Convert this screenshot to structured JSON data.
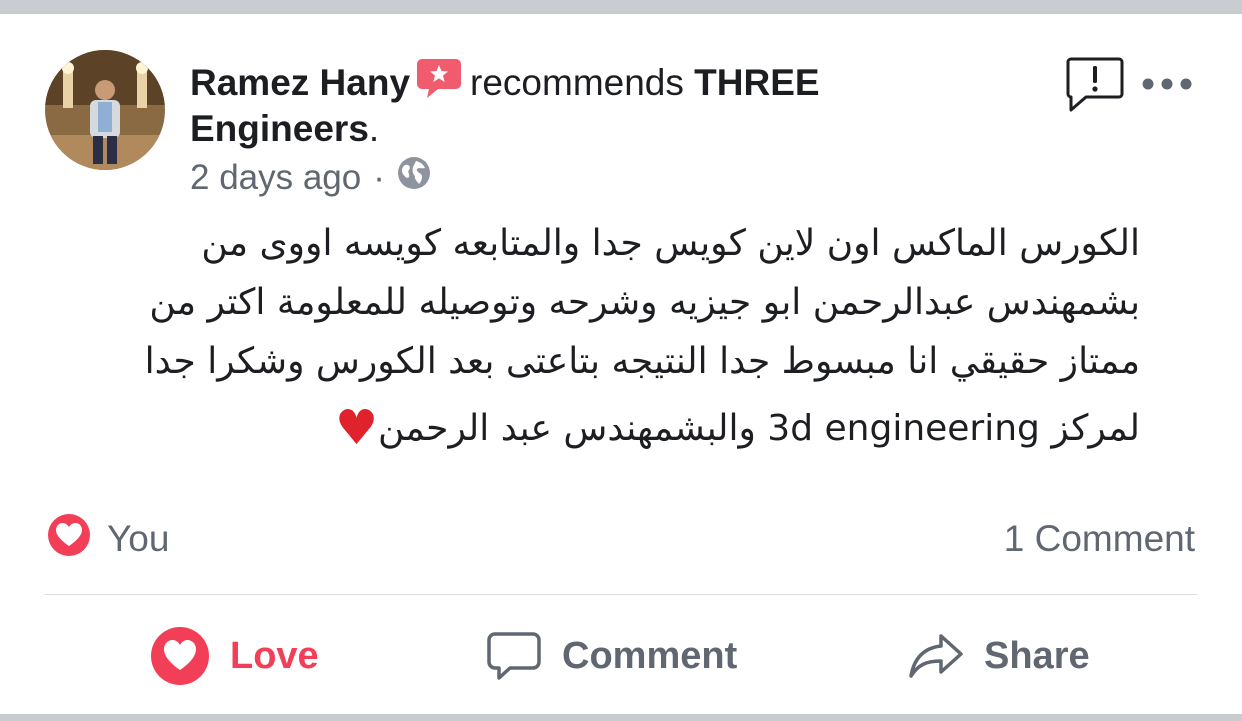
{
  "post": {
    "author": "Ramez Hany",
    "verb": "recommends",
    "page_name_line1": "THREE",
    "page_name_line2": "Engineers",
    "period": ".",
    "timestamp": "2 days ago",
    "separator": "·",
    "privacy_icon": "globe-icon",
    "text_lines": [
      "الكورس الماكس اون لاين كويس جدا والمتابعه كويسه اووى من",
      "بشمهندس عبدالرحمن ابو جيزيه وشرحه وتوصيله للمعلومة اكتر من",
      "ممتاز حقيقي انا مبسوط جدا النتيجه بتاعتى بعد الكورس وشكرا جدا",
      "لمركز 3d engineering والبشمهندس عبد الرحمن"
    ],
    "heart_emoji": "♥"
  },
  "reactions": {
    "reactor": "You",
    "comments": "1 Comment"
  },
  "actions": {
    "love": "Love",
    "comment": "Comment",
    "share": "Share"
  },
  "colors": {
    "love": "#f33e58",
    "recommend_badge": "#f05b6e",
    "secondary_text": "#606770",
    "primary_text": "#1c1e21",
    "divider": "#dadde1",
    "page_background": "#c9ccd1"
  }
}
